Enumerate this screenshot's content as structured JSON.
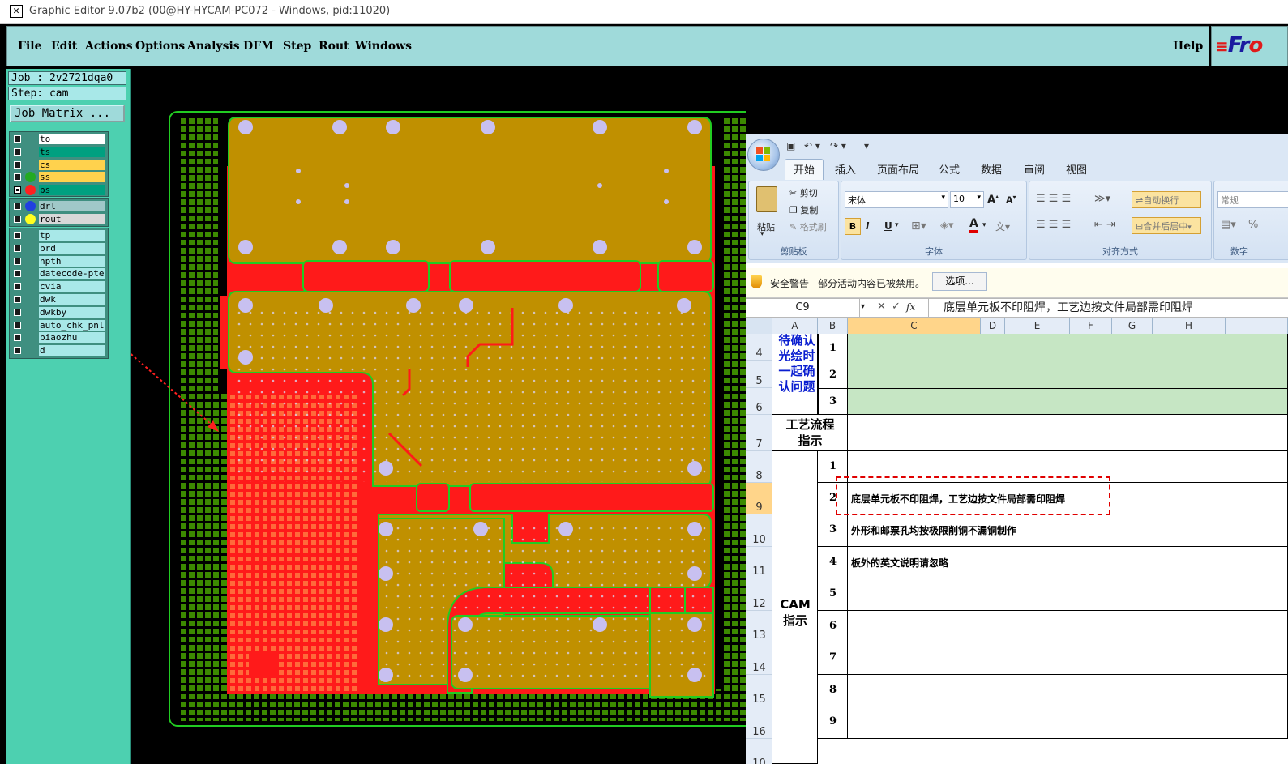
{
  "window": {
    "title": "Graphic Editor 9.07b2 (00@HY-HYCAM-PC072 - Windows, pid:11020)"
  },
  "menu": {
    "items": [
      "File",
      "Edit",
      "Actions",
      "Options",
      "Analysis",
      "DFM",
      "Step",
      "Rout",
      "Windows"
    ],
    "help": "Help",
    "logo_a": "Fr",
    "logo_b": "o"
  },
  "job": {
    "job_label": "Job : 2v2721dqa0",
    "step_label": "Step: cam",
    "matrix_button": "Job Matrix ..."
  },
  "layers": {
    "group1": [
      {
        "name": "to",
        "bg": "#ffffff",
        "dot": ""
      },
      {
        "name": "ts",
        "bg": "#00a080",
        "dot": ""
      },
      {
        "name": "cs",
        "bg": "#ffd24d",
        "dot": ""
      },
      {
        "name": "ss",
        "bg": "#ffd24d",
        "dot": "#22aa22"
      },
      {
        "name": "bs",
        "bg": "#00a080",
        "dot": "#ff2020",
        "checked": true
      }
    ],
    "group2": [
      {
        "name": "drl",
        "bg": "#a0c8c8",
        "dot": "#2040e0"
      },
      {
        "name": "rout",
        "bg": "#d8d8d8",
        "dot": "#ffff20"
      }
    ],
    "group3": [
      {
        "name": "tp",
        "bg": "#a8e8e8",
        "dot": ""
      },
      {
        "name": "brd",
        "bg": "#a8e8e8",
        "dot": ""
      },
      {
        "name": "npth",
        "bg": "#a8e8e8",
        "dot": ""
      },
      {
        "name": "datecode-pte",
        "bg": "#a8e8e8",
        "dot": ""
      },
      {
        "name": "cvia",
        "bg": "#a8e8e8",
        "dot": ""
      },
      {
        "name": "dwk",
        "bg": "#a8e8e8",
        "dot": ""
      },
      {
        "name": "dwkby",
        "bg": "#a8e8e8",
        "dot": ""
      },
      {
        "name": "auto_chk_pnl",
        "bg": "#a8e8e8",
        "dot": ""
      },
      {
        "name": "biaozhu",
        "bg": "#a8e8e8",
        "dot": ""
      },
      {
        "name": "d",
        "bg": "#a8e8e8",
        "dot": ""
      }
    ]
  },
  "excel": {
    "tabs": [
      "开始",
      "插入",
      "页面布局",
      "公式",
      "数据",
      "审阅",
      "视图"
    ],
    "clipboard": {
      "paste": "粘贴",
      "cut": "剪切",
      "copy": "复制",
      "format": "格式刷",
      "label": "剪贴板"
    },
    "font": {
      "name": "宋体",
      "size": "10",
      "bold": "B",
      "italic": "I",
      "underline": "U",
      "label": "字体"
    },
    "align": {
      "wrap": "自动换行",
      "merge": "合并后居中",
      "label": "对齐方式"
    },
    "number": {
      "format": "常规",
      "percent": "%",
      "label": "数字"
    },
    "security": {
      "title": "安全警告",
      "message": "部分活动内容已被禁用。",
      "options_button": "选项..."
    },
    "namebox": "C9",
    "formula_icon": "fx",
    "formula": "底层单元板不印阻焊，工艺边按文件局部需印阻焊",
    "columns": [
      "A",
      "B",
      "C",
      "D",
      "E",
      "F",
      "G",
      "H"
    ],
    "rows": [
      "4",
      "5",
      "6",
      "7",
      "8",
      "9",
      "10",
      "11",
      "12",
      "13",
      "14",
      "15",
      "16",
      "10"
    ],
    "cells": {
      "confirm_label": "待确认光绘时一起确认问题",
      "confirm_lines": [
        "待确认",
        "光绘时",
        "一起确",
        "认问题"
      ],
      "confirm_nums": [
        "1",
        "2",
        "3"
      ],
      "process_lines": [
        "工艺流程",
        "指示"
      ],
      "cam_lines": [
        "CAM",
        "指示"
      ],
      "cam_nums": [
        "1",
        "2",
        "3",
        "4",
        "5",
        "6",
        "7",
        "8",
        "9"
      ],
      "cam_items": [
        "",
        "底层单元板不印阻焊，工艺边按文件局部需印阻焊",
        "外形和邮票孔均按极限削铜不漏铜制作",
        "板外的英文说明请忽略",
        "",
        "",
        "",
        "",
        ""
      ]
    }
  }
}
